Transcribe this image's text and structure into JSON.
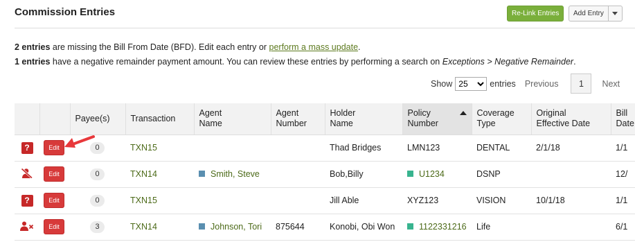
{
  "header": {
    "title": "Commission Entries",
    "relink_label": "Re-Link Entries",
    "add_entry_label": "Add Entry"
  },
  "notices": {
    "line1_count": "2 entries",
    "line1_text": " are missing the Bill From Date (BFD). Edit each entry or ",
    "line1_link": "perform a mass update",
    "line1_end": ".",
    "line2_count": "1 entries",
    "line2_text": " have a negative remainder payment amount. You can review these entries by performing a search on ",
    "line2_path": "Exceptions > Negative Remainder",
    "line2_end": "."
  },
  "pager": {
    "show_label": "Show",
    "page_size": "25",
    "entries_label": "entries",
    "previous_label": "Previous",
    "current_page": "1",
    "next_label": "Next"
  },
  "table": {
    "columns": [
      "",
      "",
      "Payee(s)",
      "Transaction",
      "Agent Name",
      "Agent Number",
      "Holder Name",
      "Policy Number",
      "Coverage Type",
      "Original Effective Date",
      "Bill Date"
    ],
    "column_html": [
      "",
      "",
      "Payee(s)",
      "Transaction",
      "Agent\nName",
      "Agent\nNumber",
      "Holder\nName",
      "Policy\nNumber",
      "Coverage\nType",
      "Original\nEffective Date",
      "Bill\nDate"
    ],
    "sorted_column": "Policy Number",
    "edit_label": "Edit",
    "rows": [
      {
        "status_icon": "question-icon",
        "payees": "0",
        "transaction": "TXN15",
        "agent_name": "",
        "agent_number": "",
        "holder_name": "Thad Bridges",
        "policy_number": "LMN123",
        "coverage_type": "DENTAL",
        "original_effective_date": "2/1/18",
        "bill_date": "1/1"
      },
      {
        "status_icon": "user-slash-icon",
        "payees": "0",
        "transaction": "TXN14",
        "agent_name": "Smith, Steve",
        "agent_number": "",
        "holder_name": "Bob,Billy",
        "policy_number": "U1234",
        "coverage_type": "DSNP",
        "original_effective_date": "",
        "bill_date": "12/"
      },
      {
        "status_icon": "question-icon",
        "payees": "0",
        "transaction": "TXN15",
        "agent_name": "",
        "agent_number": "",
        "holder_name": "Jill Able",
        "policy_number": "XYZ123",
        "coverage_type": "VISION",
        "original_effective_date": "10/1/18",
        "bill_date": "1/1"
      },
      {
        "status_icon": "user-x-icon",
        "payees": "3",
        "transaction": "TXN14",
        "agent_name": "Johnson, Tori",
        "agent_number": "875644",
        "holder_name": "Konobi, Obi Won",
        "policy_number": "1122331216",
        "coverage_type": "Life",
        "original_effective_date": "",
        "bill_date": "6/1"
      }
    ]
  },
  "colors": {
    "relink_bg": "#7aaf3b",
    "edit_bg": "#d73a3a",
    "icon_red": "#c62828",
    "link_green": "#4c6a18",
    "agent_marker": "#5a8fb0",
    "policy_marker": "#38b48f"
  }
}
